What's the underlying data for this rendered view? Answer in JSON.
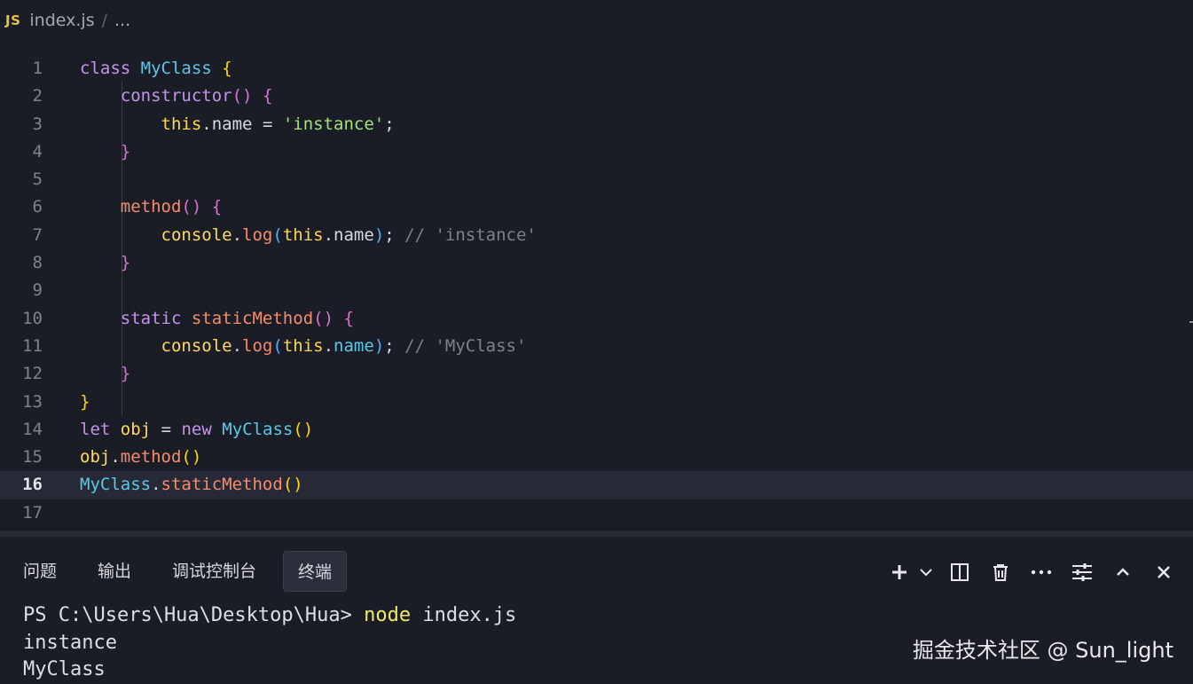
{
  "breadcrumb": {
    "icon": "JS",
    "file": "index.js",
    "separator": "/",
    "ellipsis": "..."
  },
  "editor": {
    "active_line": 16,
    "line_numbers": [
      "1",
      "2",
      "3",
      "4",
      "5",
      "6",
      "7",
      "8",
      "9",
      "10",
      "11",
      "12",
      "13",
      "14",
      "15",
      "16",
      "17"
    ]
  },
  "panel": {
    "tabs": [
      "问题",
      "输出",
      "调试控制台",
      "终端"
    ],
    "selected_tab": "终端",
    "tools": [
      "add-icon",
      "chevron-down-icon",
      "split-icon",
      "trash-icon",
      "more-icon",
      "settings-sliders-icon",
      "chevron-up-icon",
      "close-icon"
    ]
  },
  "terminal": {
    "prompt": "PS C:\\Users\\Hua\\Desktop\\Hua> ",
    "command": "node",
    "args": " index.js",
    "output": [
      "instance",
      "MyClass"
    ]
  },
  "watermark": "掘金技术社区 @ Sun_light"
}
